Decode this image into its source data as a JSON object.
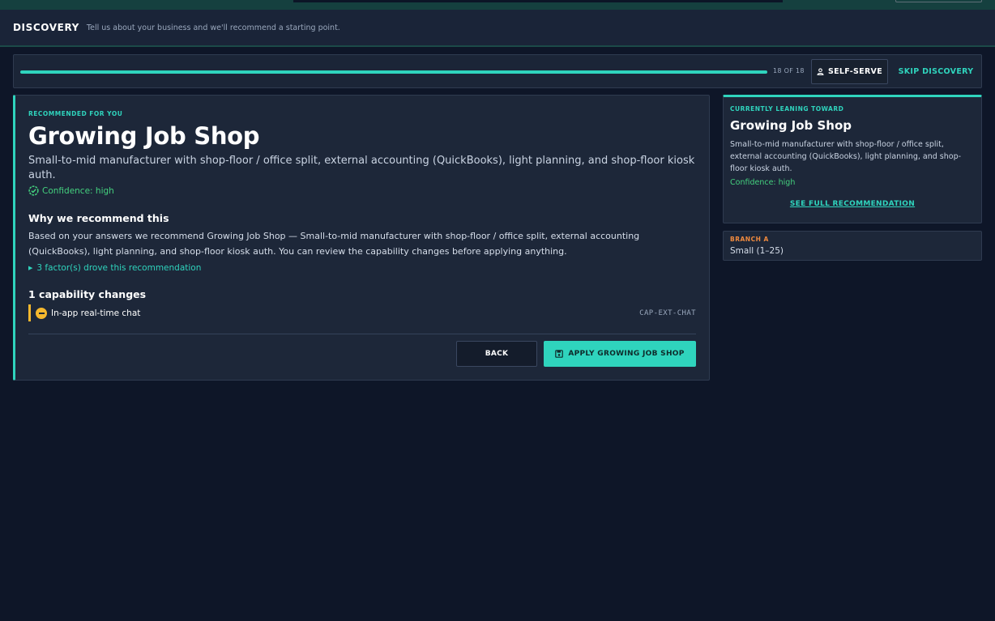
{
  "header": {
    "brand": "DISCOVERY",
    "tagline": "Tell us about your business and we'll recommend a starting point."
  },
  "progress": {
    "fraction": 1.0,
    "step_label": "18 OF 18",
    "self_serve_label": "SELF-SERVE",
    "skip_label": "SKIP DISCOVERY"
  },
  "recommendation": {
    "eyebrow": "RECOMMENDED FOR YOU",
    "title": "Growing Job Shop",
    "summary": "Small-to-mid manufacturer with shop-floor / office split, external accounting (QuickBooks), light planning, and shop-floor kiosk auth.",
    "confidence": "Confidence: high",
    "why_heading": "Why we recommend this",
    "why_text": "Based on your answers we recommend Growing Job Shop — Small-to-mid manufacturer with shop-floor / office split, external accounting (QuickBooks), light planning, and shop-floor kiosk auth. You can review the capability changes before applying anything.",
    "factors_label": "3 factor(s) drove this recommendation",
    "capabilities_heading": "1 capability changes",
    "capabilities": [
      {
        "name": "In-app real-time chat",
        "code": "CAP-EXT-CHAT"
      }
    ],
    "back_label": "BACK",
    "apply_label": "APPLY GROWING JOB SHOP"
  },
  "leaning": {
    "eyebrow": "CURRENTLY LEANING TOWARD",
    "title": "Growing Job Shop",
    "description": "Small-to-mid manufacturer with shop-floor / office split, external accounting (QuickBooks), light planning, and shop-floor kiosk auth.",
    "confidence": "Confidence: high",
    "see_full_label": "SEE FULL RECOMMENDATION"
  },
  "branch": {
    "label": "BRANCH A",
    "value": "Small (1–25)"
  },
  "colors": {
    "accent": "#2fd4bd",
    "success": "#44d17e",
    "warning": "#f5b82e",
    "branch": "#f08a3e",
    "background": "#0e1628"
  },
  "icons": {
    "self_serve": "person-icon",
    "confidence": "check-badge-icon",
    "factors": "caret-right-icon",
    "capability": "minus-circle-icon",
    "apply": "save-icon"
  }
}
